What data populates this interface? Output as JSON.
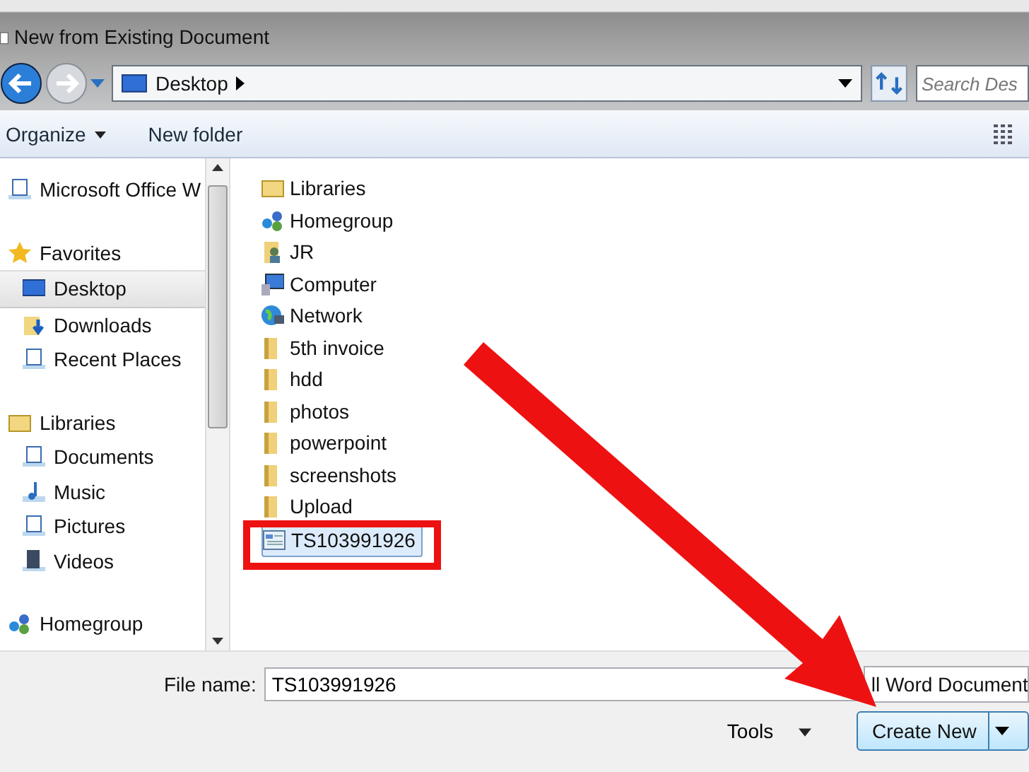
{
  "window": {
    "title": "New from Existing Document"
  },
  "address_bar": {
    "path": "Desktop"
  },
  "search": {
    "placeholder": "Search Des"
  },
  "toolbar": {
    "organize": "Organize",
    "new_folder": "New folder"
  },
  "sidebar": {
    "items": [
      {
        "label": "Microsoft Office W",
        "kind": "group",
        "selected": false
      },
      {
        "label": "Favorites",
        "kind": "group",
        "selected": false
      },
      {
        "label": "Desktop",
        "kind": "item",
        "selected": true
      },
      {
        "label": "Downloads",
        "kind": "item",
        "selected": false
      },
      {
        "label": "Recent Places",
        "kind": "item",
        "selected": false
      },
      {
        "label": "Libraries",
        "kind": "group",
        "selected": false
      },
      {
        "label": "Documents",
        "kind": "item",
        "selected": false
      },
      {
        "label": "Music",
        "kind": "item",
        "selected": false
      },
      {
        "label": "Pictures",
        "kind": "item",
        "selected": false
      },
      {
        "label": "Videos",
        "kind": "item",
        "selected": false
      },
      {
        "label": "Homegroup",
        "kind": "group",
        "selected": false
      }
    ]
  },
  "files": [
    {
      "name": "Libraries",
      "selected": false
    },
    {
      "name": "Homegroup",
      "selected": false
    },
    {
      "name": "JR",
      "selected": false
    },
    {
      "name": "Computer",
      "selected": false
    },
    {
      "name": "Network",
      "selected": false
    },
    {
      "name": "5th invoice",
      "selected": false
    },
    {
      "name": "hdd",
      "selected": false
    },
    {
      "name": "photos",
      "selected": false
    },
    {
      "name": "powerpoint",
      "selected": false
    },
    {
      "name": "screenshots",
      "selected": false
    },
    {
      "name": "Upload",
      "selected": false
    },
    {
      "name": "TS103991926",
      "selected": true
    }
  ],
  "file_name": {
    "label": "File name:",
    "value": "TS103991926"
  },
  "file_type": {
    "value": "ll Word Document"
  },
  "buttons": {
    "tools": "Tools",
    "create": "Create New"
  }
}
